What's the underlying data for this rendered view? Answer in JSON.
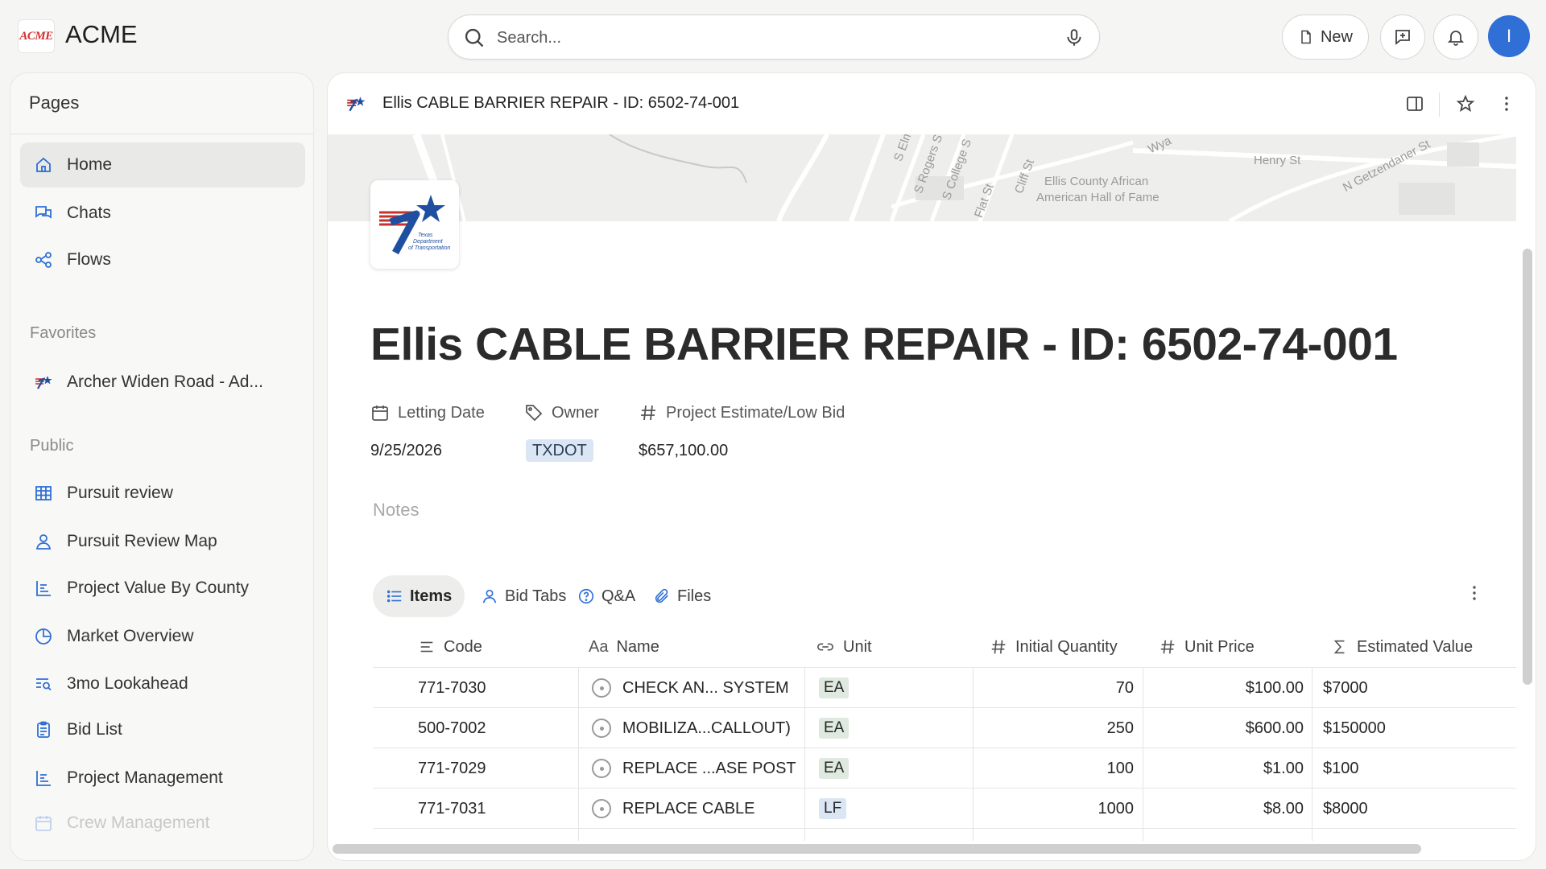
{
  "app": {
    "logo_text": "ACME",
    "brand": "ACME"
  },
  "search": {
    "placeholder": "Search..."
  },
  "topbar": {
    "new_label": "New",
    "avatar_initial": "I"
  },
  "sidebar": {
    "header": "Pages",
    "main_items": [
      {
        "label": "Home",
        "icon": "home-icon",
        "active": true
      },
      {
        "label": "Chats",
        "icon": "chats-icon"
      },
      {
        "label": "Flows",
        "icon": "flows-icon"
      }
    ],
    "favorites_title": "Favorites",
    "favorites": [
      {
        "label": "Archer Widen Road - Ad...",
        "icon": "txdot-favicon-icon"
      }
    ],
    "public_title": "Public",
    "public_items": [
      {
        "label": "Pursuit review",
        "icon": "table-icon"
      },
      {
        "label": "Pursuit Review Map",
        "icon": "map-pin-icon"
      },
      {
        "label": "Project Value By County",
        "icon": "bar-chart-icon"
      },
      {
        "label": "Market Overview",
        "icon": "pie-chart-icon"
      },
      {
        "label": "3mo Lookahead",
        "icon": "list-search-icon"
      },
      {
        "label": "Bid List",
        "icon": "clipboard-icon"
      },
      {
        "label": "Project Management",
        "icon": "bar-chart-icon"
      },
      {
        "label": "Crew Management",
        "icon": "calendar-icon"
      }
    ]
  },
  "page": {
    "header_title": "Ellis CABLE BARRIER REPAIR - ID: 6502-74-001",
    "title": "Ellis CABLE BARRIER REPAIR - ID: 6502-74-001",
    "logo_text": [
      "Texas",
      "Department",
      "of Transportation"
    ],
    "map_labels": [
      "Henry St",
      "Ellis County African",
      "American Hall of Fame",
      "N Getzendaner St",
      "S Elm",
      "S Rogers S",
      "S College S",
      "Flat St",
      "Cliff St",
      "Wya"
    ],
    "properties": {
      "letting_date_label": "Letting Date",
      "letting_date": "9/25/2026",
      "owner_label": "Owner",
      "owner": "TXDOT",
      "estimate_label": "Project Estimate/Low Bid",
      "estimate": "$657,100.00"
    },
    "notes_placeholder": "Notes",
    "tabs": [
      "Items",
      "Bid Tabs",
      "Q&A",
      "Files"
    ],
    "table": {
      "columns": [
        "Code",
        "Name",
        "Unit",
        "Initial Quantity",
        "Unit Price",
        "Estimated Value"
      ],
      "name_col_prefix": "Aa",
      "rows": [
        {
          "code": "771-7030",
          "name": "CHECK AN... SYSTEM",
          "unit": "EA",
          "qty": "70",
          "price": "$100.00",
          "value": "$7000"
        },
        {
          "code": "500-7002",
          "name": "MOBILIZA...CALLOUT)",
          "unit": "EA",
          "qty": "250",
          "price": "$600.00",
          "value": "$150000"
        },
        {
          "code": "771-7029",
          "name": "REPLACE ...ASE POST",
          "unit": "EA",
          "qty": "100",
          "price": "$1.00",
          "value": "$100"
        },
        {
          "code": "771-7031",
          "name": "REPLACE CABLE",
          "unit": "LF",
          "qty": "1000",
          "price": "$8.00",
          "value": "$8000"
        }
      ]
    }
  },
  "colors": {
    "accent": "#2f6fd6",
    "chip_ea_bg": "#dfe9df",
    "chip_lf_bg": "#dbe6f4",
    "owner_badge_bg": "#dbe6f4"
  }
}
